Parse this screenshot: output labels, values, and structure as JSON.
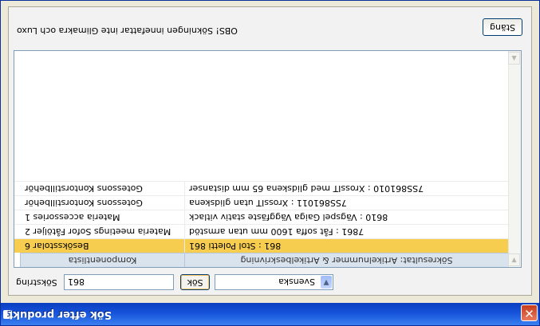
{
  "window": {
    "title": "Sök efter produkt"
  },
  "search": {
    "label": "Sökstring",
    "value": "861",
    "button": "Sök",
    "language": "Svenska"
  },
  "grid": {
    "columns": [
      "Sökresultat: Artikelnummer & Artikelbeskrivning",
      "Komponentlista"
    ],
    "rows": [
      {
        "result": "861 : Stol Poletti 861",
        "component": "Besöksstolar 6",
        "selected": true
      },
      {
        "result": "7861 : Fåt soffa 1600 mm utan armstöd",
        "component": "Materia meetings Sofor Fåtöljer 2",
        "selected": false
      },
      {
        "result": "8610 : Vägspel Gaiga Väggfäste stativ vitlack",
        "component": "Materia accessories 1",
        "selected": false
      },
      {
        "result": "7SS861011 : XrossIT utan glidskena",
        "component": "Gotessons Kontorstillbehör",
        "selected": false
      },
      {
        "result": "7SS861010 : XrossIT med glidskena 65 mm distanser",
        "component": "Gotessons Kontorstillbehör",
        "selected": false
      }
    ]
  },
  "footer": {
    "status": "OBS! Sökningen innefattar inte Glimakra och Luxo",
    "close_button": "Stäng"
  },
  "colors": {
    "titlebar": "#1f5fe0",
    "selected_row": "#f7cd4f",
    "header": "#d9e3ee"
  }
}
